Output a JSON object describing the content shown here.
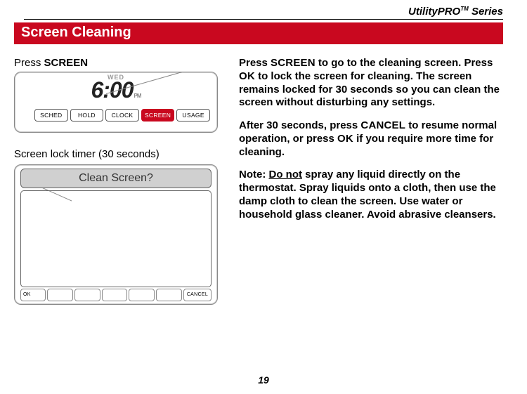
{
  "brand": {
    "name": "UtilityPRO",
    "tm": "TM",
    "series": " Series"
  },
  "section_title": "Screen Cleaning",
  "left": {
    "press_pre": "Press ",
    "press_btn": "SCREEN",
    "thermo1": {
      "day": "WED",
      "time": "6:00",
      "ampm": "PM",
      "buttons": [
        "SCHED",
        "HOLD",
        "CLOCK",
        "SCREEN",
        "USAGE"
      ],
      "active_index": 3
    },
    "lock_label": "Screen lock timer (30 seconds)",
    "thermo2": {
      "prompt": "Clean Screen?",
      "ok": "OK",
      "cancel": "CANCEL"
    }
  },
  "right": {
    "p1_a": "Press ",
    "p1_b": "SCREEN",
    "p1_c": " to go to the cleaning screen. Press ",
    "p1_d": "OK",
    "p1_e": " to lock the screen for cleaning. The screen remains locked for 30 seconds so you can clean the screen without disturbing any settings.",
    "p2_a": "After 30 seconds, press ",
    "p2_b": "CANCEL",
    "p2_c": " to resume normal operation, or press ",
    "p2_d": "OK",
    "p2_e": " if you require more time for cleaning.",
    "note_label": "Note:",
    "note_u": "Do not",
    "note_rest": " spray any liquid directly on the thermostat. Spray liquids onto a cloth, then use the damp cloth to clean the screen. Use water or household glass cleaner. Avoid abrasive cleansers."
  },
  "page_number": "19"
}
